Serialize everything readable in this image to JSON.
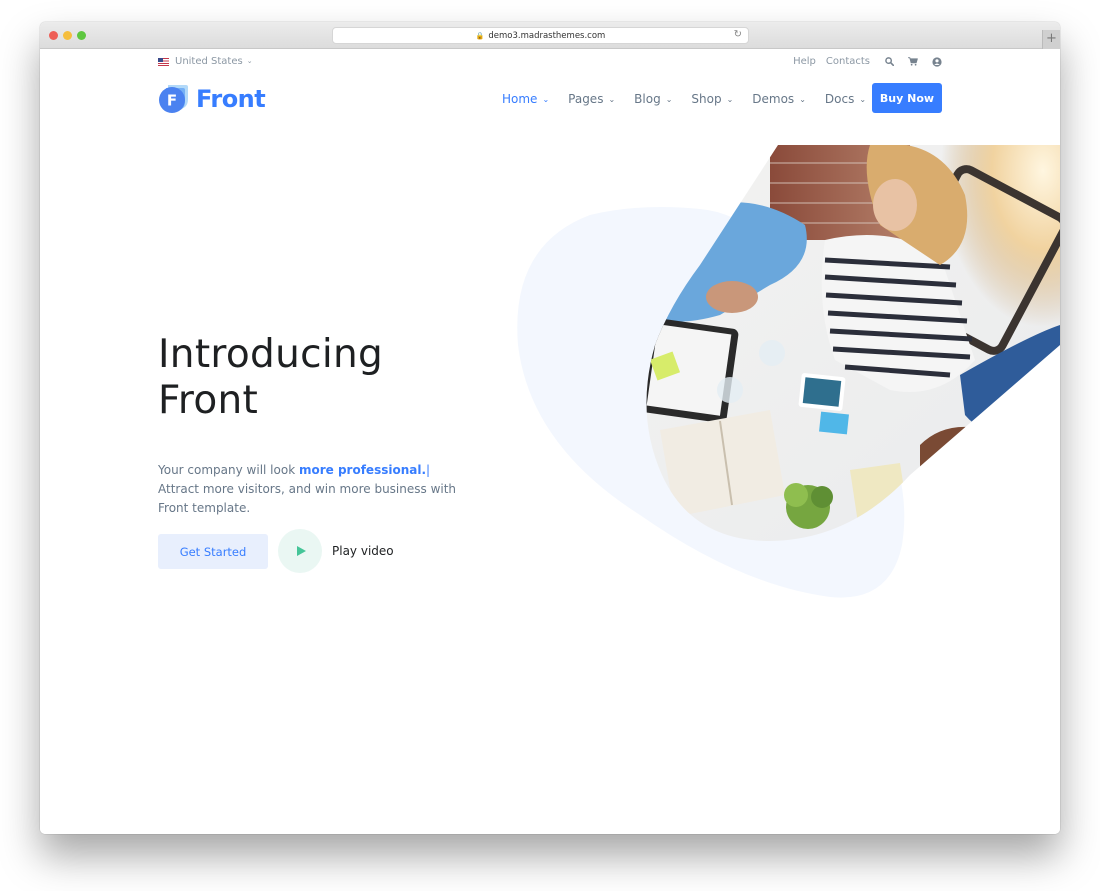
{
  "browser": {
    "url": "demo3.madrasthemes.com",
    "lock_icon": "lock-icon",
    "reload_icon": "reload-icon",
    "new_tab_icon": "plus-icon"
  },
  "topbar": {
    "locale": "United States",
    "links": [
      "Help",
      "Contacts"
    ],
    "icons": [
      "search-icon",
      "cart-icon",
      "user-circle-icon"
    ]
  },
  "brand": {
    "name": "Front",
    "logo_letter": "F",
    "color": "#377dff"
  },
  "nav": {
    "items": [
      {
        "label": "Home",
        "active": true
      },
      {
        "label": "Pages",
        "active": false
      },
      {
        "label": "Blog",
        "active": false
      },
      {
        "label": "Shop",
        "active": false
      },
      {
        "label": "Demos",
        "active": false
      },
      {
        "label": "Docs",
        "active": false
      }
    ],
    "cta": "Buy Now"
  },
  "hero": {
    "title_line1": "Introducing",
    "title_line2": "Front",
    "desc_prefix": "Your company will look ",
    "desc_highlight": "more professional.",
    "desc_cursor": "|",
    "desc_rest": "Attract more visitors, and win more business with Front template.",
    "primary_button": "Get Started",
    "video_label": "Play video",
    "image_alt": "Team meeting around a table viewed from above"
  },
  "colors": {
    "primary": "#377dff",
    "primary_soft": "#e8effd",
    "play_green": "#45c598",
    "play_bg": "#eaf7f3",
    "blob": "#f3f7fe",
    "text_dark": "#1e2022",
    "text_muted": "#677788"
  }
}
